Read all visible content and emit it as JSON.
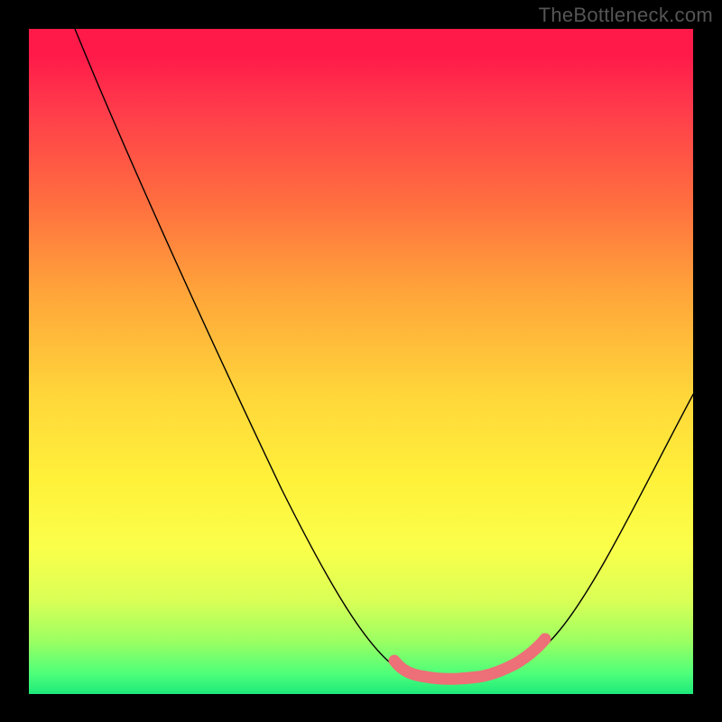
{
  "watermark": "TheBottleneck.com",
  "colors": {
    "page_bg": "#000000",
    "overlay_stroke": "#ed6f77",
    "curve_stroke": "#000000",
    "watermark": "#555555"
  },
  "chart_data": {
    "type": "line",
    "title": "",
    "xlabel": "",
    "ylabel": "",
    "xlim": [
      0,
      100
    ],
    "ylim": [
      0,
      100
    ],
    "grid": false,
    "legend": false,
    "series": [
      {
        "name": "bottleneck-curve",
        "x": [
          7,
          12,
          18,
          24,
          30,
          36,
          42,
          48,
          52,
          56,
          59,
          62,
          66,
          70,
          74,
          77,
          82,
          88,
          94,
          100
        ],
        "y": [
          100,
          89,
          76,
          64,
          53,
          42,
          32,
          22,
          14,
          8,
          5,
          4,
          4,
          4,
          5,
          7,
          13,
          22,
          33,
          45
        ]
      },
      {
        "name": "highlight-segment",
        "x": [
          56,
          59,
          62,
          66,
          70,
          74,
          77
        ],
        "y": [
          8,
          5,
          4,
          4,
          4,
          5,
          7
        ]
      }
    ],
    "gradient_stops": [
      {
        "pos": 0,
        "color": "#ff1a4a"
      },
      {
        "pos": 50,
        "color": "#ffe03a"
      },
      {
        "pos": 100,
        "color": "#1de97a"
      }
    ]
  }
}
